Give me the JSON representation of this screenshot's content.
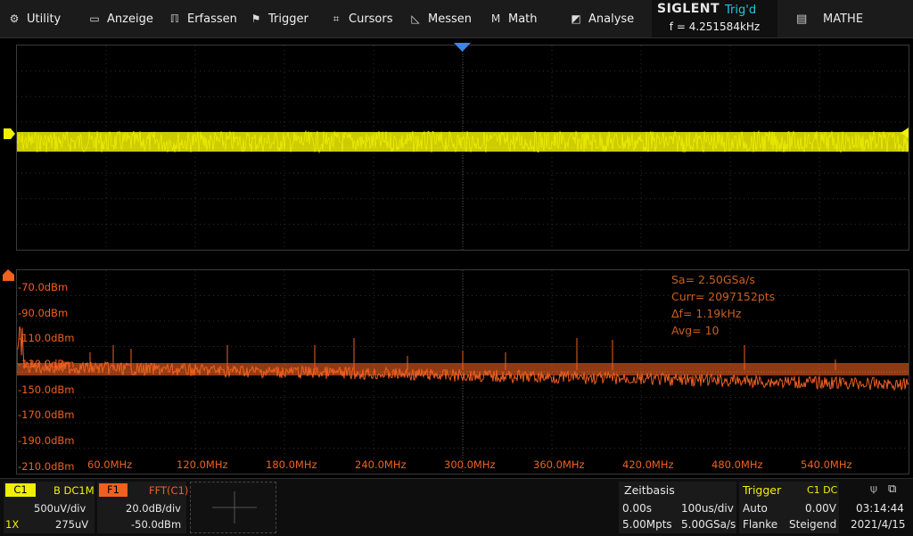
{
  "menu": {
    "items": [
      {
        "label": "Utility",
        "icon": "gear-icon"
      },
      {
        "label": "Anzeige",
        "icon": "monitor-icon"
      },
      {
        "label": "Erfassen",
        "icon": "acquire-icon"
      },
      {
        "label": "Trigger",
        "icon": "flag-icon"
      },
      {
        "label": "Cursors",
        "icon": "crosshair-icon"
      },
      {
        "label": "Messen",
        "icon": "ruler-icon"
      },
      {
        "label": "Math",
        "icon": "math-icon"
      },
      {
        "label": "Analyse",
        "icon": "analysis-icon"
      }
    ]
  },
  "brand": {
    "logo": "SIGLENT",
    "status": "Trig'd",
    "frequency": "f = 4.251584kHz"
  },
  "math_button": {
    "label": "MATHE",
    "icon": "doc-icon"
  },
  "fft": {
    "db_labels": [
      "-70.0dBm",
      "-90.0dBm",
      "-110.0dBm",
      "-130.0dBm",
      "-150.0dBm",
      "-170.0dBm",
      "-190.0dBm",
      "-210.0dBm"
    ],
    "freq_labels": [
      "60.0MHz",
      "120.0MHz",
      "180.0MHz",
      "240.0MHz",
      "300.0MHz",
      "360.0MHz",
      "420.0MHz",
      "480.0MHz",
      "540.0MHz"
    ],
    "info": {
      "sa": "Sa=  2.50GSa/s",
      "curr": "Curr= 2097152pts",
      "df": "Δf=  1.19kHz",
      "avg": "Avg= 10"
    },
    "colors": {
      "trace": "#f06020",
      "c1": "#f0f000"
    }
  },
  "channel1": {
    "name": "C1",
    "coupling": "B DC1M",
    "scale": "500uV/div",
    "probe": "1X",
    "offset": "275uV"
  },
  "function1": {
    "name": "F1",
    "source": "FFT(C1)",
    "scale": "20.0dB/div",
    "offset": "-50.0dBm"
  },
  "timebase": {
    "title": "Zeitbasis",
    "delay": "0.00s",
    "scale": "100us/div",
    "depth": "5.00Mpts",
    "rate": "5.00GSa/s"
  },
  "trigger": {
    "title": "Trigger",
    "source": "C1 DC",
    "mode": "Auto",
    "level": "0.00V",
    "type": "Flanke",
    "slope": "Steigend"
  },
  "clock": {
    "time": "03:14:44",
    "date": "2021/4/15"
  }
}
